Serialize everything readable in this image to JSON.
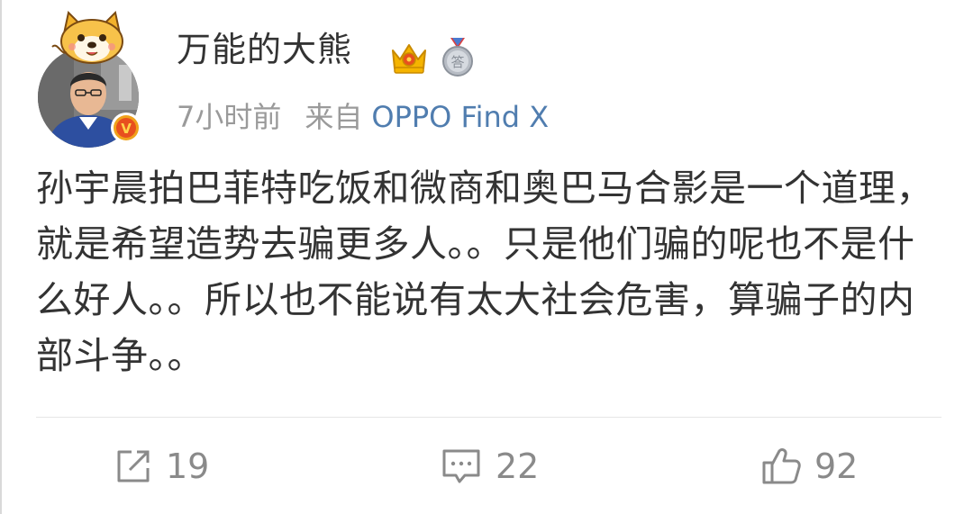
{
  "post": {
    "username": "万能的大熊",
    "time": "7小时前",
    "source_label": "来自",
    "source_device": "OPPO Find X",
    "content": "孙宇晨拍巴菲特吃饭和微商和奥巴马合影是一个道理，就是希望造势去骗更多人。。只是他们骗的呢也不是什么好人。。所以也不能说有太大社会危害，算骗子的内部斗争。。",
    "badges": {
      "vip_icon": "crown-icon",
      "medal_icon": "medal-icon",
      "medal_text": "答",
      "verified_text": "V"
    }
  },
  "actions": {
    "repost_count": "19",
    "comment_count": "22",
    "like_count": "92"
  },
  "colors": {
    "text": "#333333",
    "meta": "#9a9a9a",
    "link": "#507daf",
    "icon": "#8a8a8a",
    "verified_badge": "#f0a21b",
    "crown": "#f5b400"
  }
}
